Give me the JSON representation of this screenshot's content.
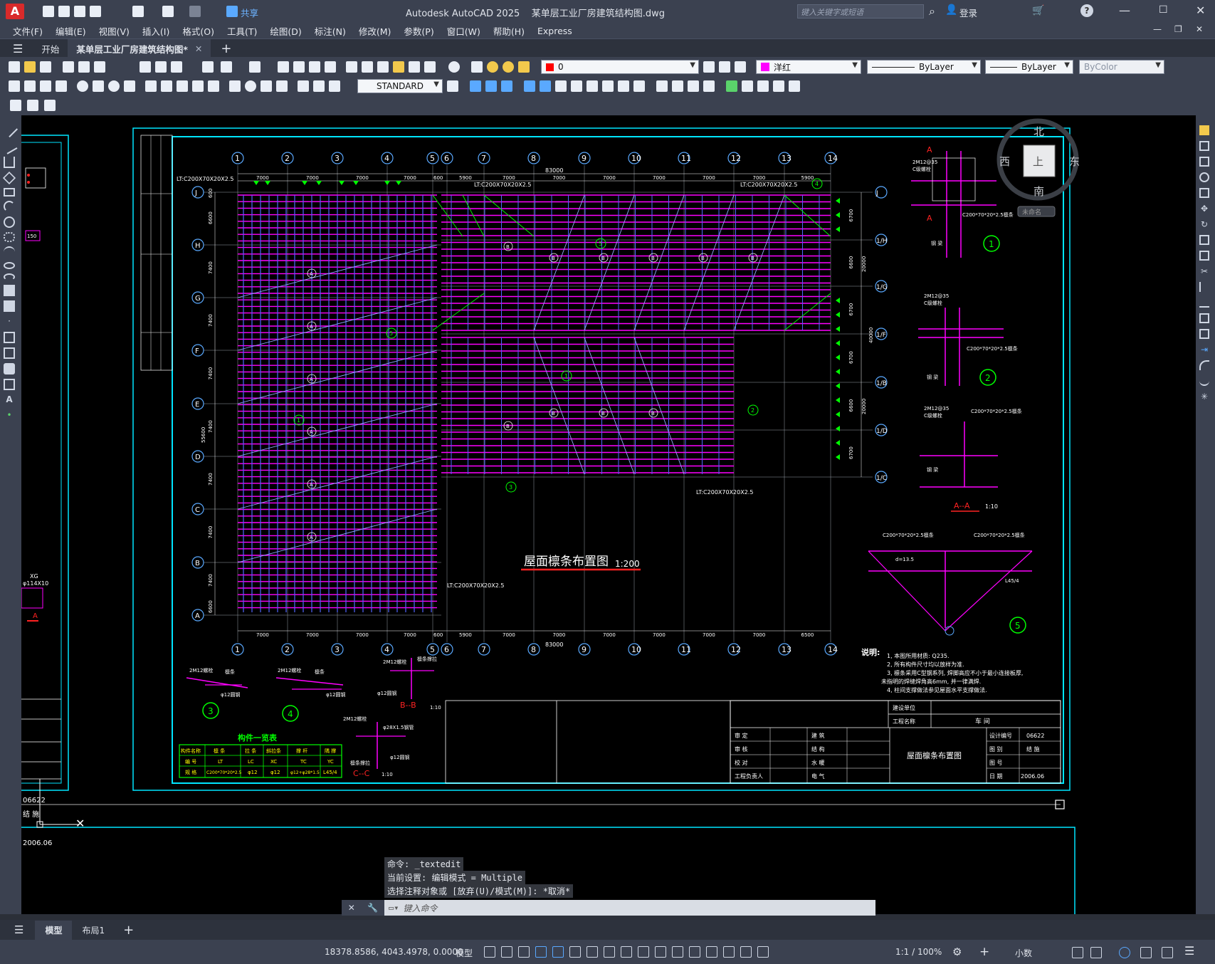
{
  "window": {
    "app_title": "Autodesk AutoCAD 2025",
    "file_name": "某单层工业厂房建筑结构图.dwg",
    "share_label": "共享",
    "search_placeholder": "键入关键字或短语",
    "login_label": "登录"
  },
  "menu": [
    "文件(F)",
    "编辑(E)",
    "视图(V)",
    "插入(I)",
    "格式(O)",
    "工具(T)",
    "绘图(D)",
    "标注(N)",
    "修改(M)",
    "参数(P)",
    "窗口(W)",
    "帮助(H)",
    "Express"
  ],
  "tabs": {
    "start": "开始",
    "drawing": "某单层工业厂房建筑结构图*",
    "new_tab": "+"
  },
  "properties": {
    "layer": "0",
    "color": "洋红",
    "color_hex": "#ff00ff",
    "linetype": "ByLayer",
    "lineweight": "ByLayer",
    "plotstyle": "ByColor",
    "text_style": "STANDARD"
  },
  "viewcube": {
    "north": "北",
    "south": "南",
    "east": "东",
    "west": "西",
    "face": "上",
    "ucs": "未命名"
  },
  "drawing": {
    "title": "屋面檩条布置图",
    "scale": "1:200",
    "grid_numbers": [
      "1",
      "2",
      "3",
      "4",
      "5",
      "6",
      "7",
      "8",
      "9",
      "10",
      "11",
      "12",
      "13",
      "14"
    ],
    "grid_letters_left": [
      "J",
      "H",
      "G",
      "F",
      "E",
      "D",
      "C",
      "B",
      "A"
    ],
    "grid_letters_right": [
      "J",
      "1/H",
      "1/G",
      "1/F",
      "1/B",
      "1/D",
      "1/C"
    ],
    "dims_top": [
      "7000",
      "7000",
      "7000",
      "7000",
      "600",
      "5900",
      "7000",
      "7000",
      "7000",
      "7000",
      "7000",
      "7000",
      "5900",
      "600"
    ],
    "dims_bottom": [
      "7000",
      "7000",
      "7000",
      "7000",
      "600",
      "5900",
      "7000",
      "7000",
      "7000",
      "7000",
      "7000",
      "7000",
      "6500"
    ],
    "total_dim": "83000",
    "left_dims": [
      "600",
      "6600",
      "7400",
      "7400",
      "7400",
      "7400",
      "7400",
      "7400",
      "7400",
      "6600",
      "600"
    ],
    "left_total": "55600",
    "right_dims": [
      "6700",
      "6600",
      "6700",
      "6700",
      "6600",
      "6700"
    ],
    "right_totals": [
      "20000",
      "40000",
      "20000"
    ],
    "lt_labels": [
      "LT:C200X70X20X2.5",
      "LT:C200X70X20X2.5",
      "LT:C200X70X20X2.5",
      "LT:C200X70X20X2.5",
      "LT:C200X70X20X2.5"
    ],
    "detail_labels": {
      "d1_bolt": "2M12@35",
      "d1_plate": "C级螺栓",
      "d1_purlin": "C200*70*20*2.5檩条",
      "d1_beam": "钢 梁",
      "d2_bolt": "2M12@35",
      "d2_plate": "C级螺栓",
      "d2_purlin": "C200*70*20*2.5檩条",
      "d2_beam": "钢 梁",
      "aa_bolt": "2M12@35",
      "aa_plate": "C级螺栓",
      "aa_purlin": "C200*70*20*2.5檩条",
      "aa_beam": "钢 梁",
      "aa_title": "A--A",
      "aa_scale": "1:10",
      "d5_left": "C200*70*20*2.5檩条",
      "d5_right": "C200*70*20*2.5檩条",
      "d5_angle": "L45/4",
      "d5_d": "d=13.5",
      "bb_title": "B--B",
      "bb_scale": "1:10",
      "cc_title": "C--C",
      "cc_scale": "1:10",
      "rod": "φ12圆钢",
      "rod2": "φ28X1.5钢管",
      "tie": "檩条撑拉",
      "bolt": "2M12螺栓",
      "purlin": "檩条"
    },
    "notes": {
      "heading": "说明:",
      "lines": [
        "1, 本图所用材质: Q235.",
        "2, 所有构件尺寸均以放样为准.",
        "3, 檩条采用C型钢系列, 焊脚高应不小于最小连接板厚,",
        "未指明的焊缝焊角高6mm, 并一律满焊.",
        "4, 柱间支撑做法参见屋面水平支撑做法."
      ]
    },
    "member_table": {
      "title": "构件一览表",
      "headers": [
        "构件名称",
        "檩 条",
        "拉 条",
        "斜拉条",
        "撑 杆",
        "隅 撑"
      ],
      "row1": [
        "编 号",
        "LT",
        "LC",
        "XC",
        "TC",
        "YC"
      ],
      "row2": [
        "规 格",
        "C200*70*20*2.5",
        "φ12",
        "φ12",
        "φ12+φ28*1.5",
        "L45/4"
      ]
    },
    "title_block": {
      "build_unit": "建设单位",
      "project_name": "工程名称",
      "project_value": "车 间",
      "drawing_name": "屋面檩条布置图",
      "rows": [
        [
          "审 定",
          "建 筑",
          "设计编号",
          "06622"
        ],
        [
          "审 核",
          "结 构",
          "图 别",
          "结 施"
        ],
        [
          "校 对",
          "水 暖",
          "图 号",
          ""
        ],
        [
          "工程负责人",
          "电 气",
          "日 期",
          "2006.06"
        ]
      ],
      "left_sheet": {
        "num": "06622",
        "cat": "结 施",
        "date": "2006.06"
      }
    },
    "left_sheet_labels": {
      "pipe": "φ114X10",
      "xg": "XG",
      "c150": "150"
    }
  },
  "command": {
    "history": [
      "命令: _textedit",
      "当前设置: 编辑模式 = Multiple",
      "选择注释对象或 [放弃(U)/模式(M)]: *取消*"
    ],
    "placeholder": "键入命令"
  },
  "layout_tabs": [
    "模型",
    "布局1",
    "+"
  ],
  "status": {
    "coords": "18378.8586, 4043.4978, 0.0000",
    "space": "模型",
    "scale": "1:1 / 100%",
    "units": "小数"
  }
}
